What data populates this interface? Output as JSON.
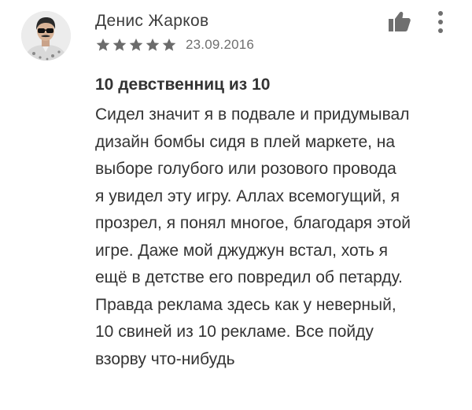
{
  "review": {
    "author_name": "Денис Жарков",
    "rating": 5,
    "rating_max": 5,
    "date": "23.09.2016",
    "title": "10 девственниц из 10",
    "body_lines": [
      "Сидел значит я в подвале и придумывал",
      "дизайн бомбы сидя в плей маркете, на",
      "выборе голубого или розового провода",
      "я увидел эту игру. Аллах всемогущий, я",
      "прозрел, я понял многое, благодаря этой",
      "игре. Даже мой джуджун встал, хоть я",
      "ещё в детстве его повредил об петарду.",
      "Правда реклама здесь как у неверный,",
      "10 свиней из 10 рекламе. Все пойду",
      "взорву что-нибудь"
    ]
  },
  "actions": {
    "helpful_icon": "thumb-up-icon",
    "more_icon": "more-vert-icon"
  },
  "colors": {
    "star": "#6b6b6b",
    "icon": "#6f6f6f",
    "text": "#333333",
    "secondary_text": "#6f6f6f"
  }
}
